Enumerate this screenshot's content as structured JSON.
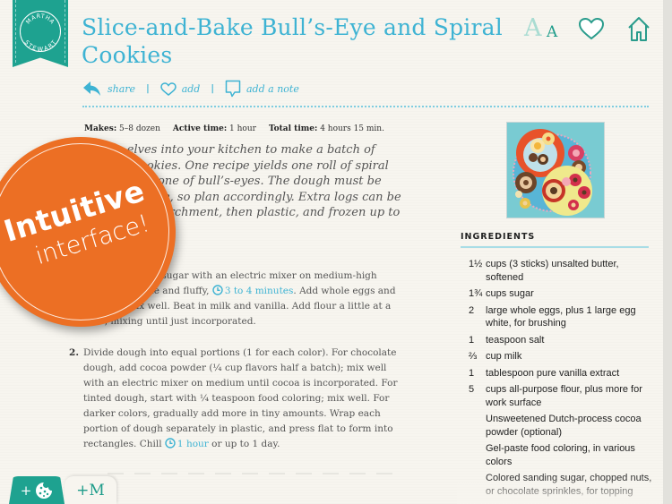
{
  "brand": {
    "logo_top": "MARTHA",
    "logo_bottom": "STEWART",
    "color": "#1ea290"
  },
  "recipe": {
    "title": "Slice-and-Bake Bull’s-Eye and Spiral Cookies",
    "actions": [
      {
        "icon": "share-arrow-icon",
        "label": "share"
      },
      {
        "icon": "heart-outline-icon",
        "label": "add"
      },
      {
        "icon": "note-bubble-icon",
        "label": "add a note"
      }
    ],
    "meta": {
      "makes_label": "Makes:",
      "makes_value": "5–8 dozen",
      "active_label": "Active time:",
      "active_value": "1 hour",
      "total_label": "Total time:",
      "total_value": "4 hours 15 min."
    },
    "intro": "…little elves into your kitchen to make a batch of colorful cookies. One recipe yields one roll of spiral cookies and one of bull’s-eyes. The dough must be chilled a while, so plan accordingly. Extra logs can be wrapped in parchment, then plastic, and frozen up to 1 month.",
    "steps": [
      {
        "num": "1.",
        "before": "Beat butter and sugar with an electric mixer on medium-high speed until pale and fluffy, ",
        "timer": "3 to 4 minutes",
        "after": ". Add whole eggs and salt, and mix well. Beat in milk and vanilla. Add flour a little at a time, mixing until just incorporated."
      },
      {
        "num": "2.",
        "before": "Divide dough into equal portions (1 for each color). For chocolate dough, add cocoa powder (¼ cup flavors half a batch); mix well with an electric mixer on medium until cocoa is incorporated. For tinted dough, start with ¼ teaspoon food coloring; mix well. For darker colors, gradually add more in tiny amounts. Wrap each portion of dough separately in plastic, and press flat to form into rectangles. Chill ",
        "timer": "1 hour",
        "after": " or up to 1 day."
      }
    ]
  },
  "ingredients": {
    "heading": "INGREDIENTS",
    "items": [
      {
        "qty": "1½",
        "desc": "cups (3 sticks) unsalted butter, softened"
      },
      {
        "qty": "1¾",
        "desc": "cups sugar"
      },
      {
        "qty": "2",
        "desc": "large whole eggs, plus 1 large egg white, for brushing"
      },
      {
        "qty": "1",
        "desc": "teaspoon salt"
      },
      {
        "qty": "⅔",
        "desc": "cup milk"
      },
      {
        "qty": "1",
        "desc": "tablespoon pure vanilla extract"
      },
      {
        "qty": "5",
        "desc": "cups all-purpose flour, plus more for work surface"
      },
      {
        "qty": "",
        "desc": "Unsweetened Dutch-process cocoa powder (optional)"
      },
      {
        "qty": "",
        "desc": "Gel-paste food coloring, in various colors"
      },
      {
        "qty": "",
        "desc": "Colored sanding sugar, chopped nuts, or chocolate sprinkles, for topping"
      }
    ]
  },
  "toolbar": {
    "font_big": "A",
    "font_small": "A"
  },
  "sticker": {
    "line1": "Intuitive",
    "line2": "interface!"
  },
  "bottom_tabs": {
    "cookie_plus": "+",
    "m_label": "+M"
  },
  "colors": {
    "accent_blue": "#3eb3d3",
    "teal": "#1ea290",
    "sticker_orange": "#ec6f24"
  }
}
